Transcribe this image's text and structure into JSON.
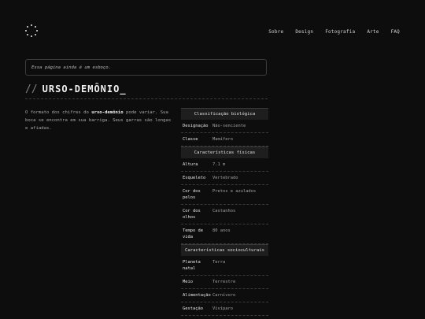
{
  "nav": {
    "items": [
      "Sobre",
      "Design",
      "Fotografia",
      "Arte",
      "FAQ"
    ]
  },
  "notice": {
    "text": "Essa página ainda é um esboço."
  },
  "title": {
    "prefix": "//",
    "text": "URSO-DEMÔNIO_"
  },
  "description": {
    "part1": "O formato dos chifres do ",
    "bold": "urso-demônio",
    "part2": " pode variar. Sua boca se encontra em sua barriga. Seus garras são longas e afiadas."
  },
  "infobox": {
    "sections": [
      {
        "heading": "Classificação biológica",
        "rows": [
          {
            "key": "Designação",
            "value": "Não-senciente"
          },
          {
            "key": "Classe",
            "value": "Mamífero"
          }
        ]
      },
      {
        "heading": "Características físicas",
        "rows": [
          {
            "key": "Altura",
            "value": "7.1 m"
          },
          {
            "key": "Esqueleto",
            "value": "Vertebrado"
          },
          {
            "key": "Cor dos pelos",
            "value": "Pretos e azulados"
          },
          {
            "key": "Cor dos olhos",
            "value": "Castanhos"
          },
          {
            "key": "Tempo de vida",
            "value": "80 anos"
          }
        ]
      },
      {
        "heading": "Características socioculturais",
        "rows": [
          {
            "key": "Planeta natal",
            "value": "Terra"
          },
          {
            "key": "Meio",
            "value": "Terrestre"
          },
          {
            "key": "Alimentação",
            "value": "Carnívoro"
          },
          {
            "key": "Gestação",
            "value": "Vivíparo"
          }
        ]
      }
    ]
  }
}
